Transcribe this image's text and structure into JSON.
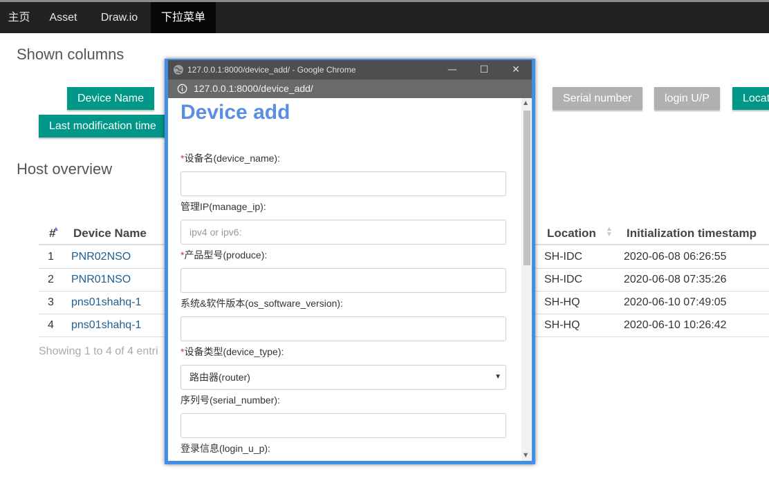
{
  "nav": {
    "items": [
      {
        "label": "主页"
      },
      {
        "label": "Asset"
      },
      {
        "label": "Draw.io"
      },
      {
        "label": "下拉菜单",
        "active": true
      }
    ]
  },
  "shown_columns": {
    "title": "Shown columns",
    "buttons": [
      {
        "label": "Device Name",
        "state": "on"
      },
      {
        "label": "Serial number",
        "state": "off"
      },
      {
        "label": "login U/P",
        "state": "off"
      },
      {
        "label": "Locat",
        "state": "on"
      },
      {
        "label": "Last modification time",
        "state": "on"
      }
    ]
  },
  "host_overview": {
    "title": "Host overview",
    "columns": [
      "#",
      "Device Name",
      "Location",
      "Initialization timestamp"
    ],
    "rows": [
      {
        "num": "1",
        "device_name": "PNR02NSO",
        "location": "SH-IDC",
        "init_ts": "2020-06-08 06:26:55"
      },
      {
        "num": "2",
        "device_name": "PNR01NSO",
        "location": "SH-IDC",
        "init_ts": "2020-06-08 07:35:26"
      },
      {
        "num": "3",
        "device_name": "pns01shahq-1",
        "location": "SH-HQ",
        "init_ts": "2020-06-10 07:49:05"
      },
      {
        "num": "4",
        "device_name": "pns01shahq-1",
        "location": "SH-HQ",
        "init_ts": "2020-06-10 10:26:42"
      }
    ],
    "showing": "Showing 1 to 4 of 4 entri"
  },
  "popup": {
    "window_title": "127.0.0.1:8000/device_add/ - Google Chrome",
    "url": "127.0.0.1:8000/device_add/",
    "controls": {
      "minimize": "—",
      "maximize": "☐",
      "close": "✕"
    },
    "form": {
      "title": "Device add",
      "required_mark": "*",
      "fields": [
        {
          "label": "设备名(device_name):",
          "required": true,
          "value": "",
          "placeholder": ""
        },
        {
          "label": "管理IP(manage_ip):",
          "required": false,
          "value": "",
          "placeholder": "ipv4 or ipv6:"
        },
        {
          "label": "产品型号(produce):",
          "required": true,
          "value": "",
          "placeholder": ""
        },
        {
          "label": "系统&软件版本(os_software_version):",
          "required": false,
          "value": "",
          "placeholder": ""
        },
        {
          "label": "设备类型(device_type):",
          "required": true,
          "value": "路由器(router)",
          "placeholder": "",
          "select": true
        },
        {
          "label": "序列号(serial_number):",
          "required": false,
          "value": "",
          "placeholder": ""
        },
        {
          "label": "登录信息(login_u_p):",
          "required": false,
          "value": "",
          "placeholder": ""
        }
      ]
    }
  },
  "colors": {
    "navbar": "#222222",
    "accent_on": "#009688",
    "accent_off": "#b0b0b0",
    "link": "#1e5f8f",
    "form_title": "#5b8ee0",
    "window_frame": "#3f8fe6"
  }
}
